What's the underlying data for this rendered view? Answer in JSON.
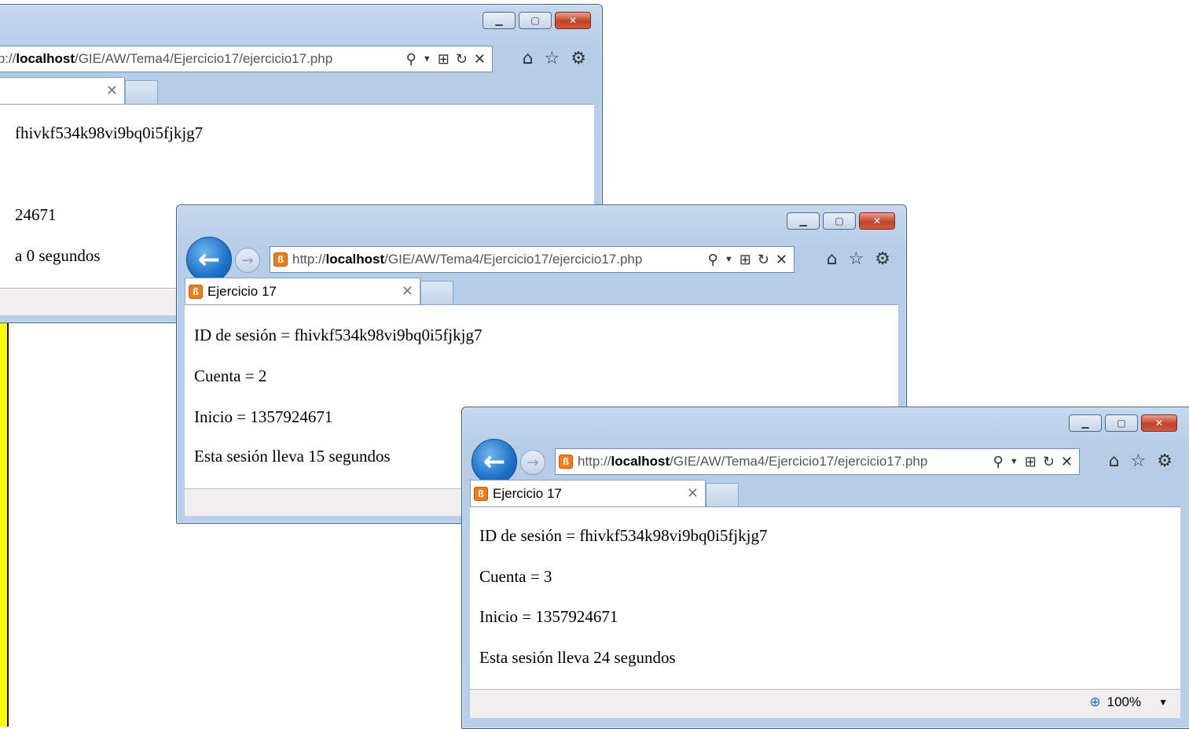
{
  "windows": [
    {
      "url_prefix": "tp://",
      "url_host": "localhost",
      "url_path": "/GIE/AW/Tema4/Ejercicio17/ejercicio17.php",
      "tab_title": "",
      "lines": [
        "fhivkf534k98vi9bq0i5fjkjg7",
        "",
        "24671",
        "a 0 segundos"
      ]
    },
    {
      "url_prefix": "http://",
      "url_host": "localhost",
      "url_path": "/GIE/AW/Tema4/Ejercicio17/ejercicio17.php",
      "tab_title": "Ejercicio 17",
      "lines": [
        "ID de sesión = fhivkf534k98vi9bq0i5fjkjg7",
        "Cuenta = 2",
        "Inicio = 1357924671",
        "Esta sesión lleva 15 segundos"
      ]
    },
    {
      "url_prefix": "http://",
      "url_host": "localhost",
      "url_path": "/GIE/AW/Tema4/Ejercicio17/ejercicio17.php",
      "tab_title": "Ejercicio 17",
      "lines": [
        "ID de sesión = fhivkf534k98vi9bq0i5fjkjg7",
        "Cuenta = 3",
        "Inicio = 1357924671",
        "Esta sesión lleva 24 segundos"
      ],
      "zoom": "100%"
    }
  ],
  "icons": [
    "minimize-icon",
    "maximize-icon",
    "close-icon",
    "back-icon",
    "forward-icon",
    "search-icon",
    "compat-icon",
    "refresh-icon",
    "stop-icon",
    "home-icon",
    "favorites-icon",
    "tools-icon",
    "xampp-favicon",
    "zoom-icon"
  ],
  "colors": {
    "chrome": "#b7cfe9",
    "close_button": "#c0432a",
    "back_button": "#1c70c7",
    "sidebar_bar": "#ffff00"
  }
}
